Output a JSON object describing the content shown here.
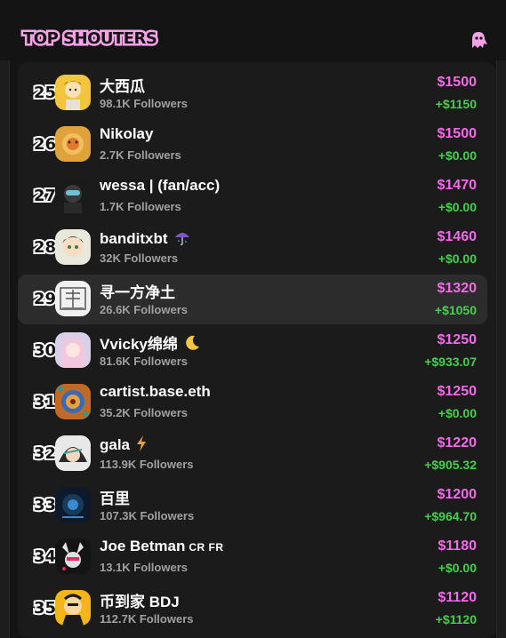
{
  "header": {
    "title": "TOP SHOUTERS",
    "icon": "ghost-icon",
    "accent": "#f4a3e6"
  },
  "colors": {
    "price": "#f26ae6",
    "change": "#43d14d",
    "followers": "#a0a0a0",
    "background": "#141414"
  },
  "rows": [
    {
      "rank": "25",
      "name": "大西瓜",
      "followers": "98.1K Followers",
      "price": "$1500",
      "change": "+$1150"
    },
    {
      "rank": "26",
      "name": "Nikolay",
      "followers": "2.7K Followers",
      "price": "$1500",
      "change": "+$0.00"
    },
    {
      "rank": "27",
      "name": "wessa | (fan/acc)",
      "followers": "1.7K Followers",
      "price": "$1470",
      "change": "+$0.00"
    },
    {
      "rank": "28",
      "name": "banditxbt",
      "followers": "32K Followers",
      "price": "$1460",
      "change": "+$0.00",
      "emoji": "umbrella-emoji"
    },
    {
      "rank": "29",
      "name": "寻一方净土",
      "followers": "26.6K Followers",
      "price": "$1320",
      "change": "+$1050",
      "highlighted": true
    },
    {
      "rank": "30",
      "name": "Vvicky绵绵",
      "followers": "81.6K Followers",
      "price": "$1250",
      "change": "+$933.07",
      "emoji": "crescent-moon-emoji"
    },
    {
      "rank": "31",
      "name": "cartist.base.eth",
      "followers": "35.2K Followers",
      "price": "$1250",
      "change": "+$0.00"
    },
    {
      "rank": "32",
      "name": "gala",
      "followers": "113.9K Followers",
      "price": "$1220",
      "change": "+$905.32",
      "emoji": "lightning-emoji"
    },
    {
      "rank": "33",
      "name": "百里",
      "followers": "107.3K Followers",
      "price": "$1200",
      "change": "+$964.70"
    },
    {
      "rank": "34",
      "name": "Joe Betman",
      "badge": "CR FR",
      "followers": "13.1K Followers",
      "price": "$1180",
      "change": "+$0.00"
    },
    {
      "rank": "35",
      "name": "币到家 BDJ",
      "followers": "112.7K Followers",
      "price": "$1120",
      "change": "+$1120"
    }
  ]
}
